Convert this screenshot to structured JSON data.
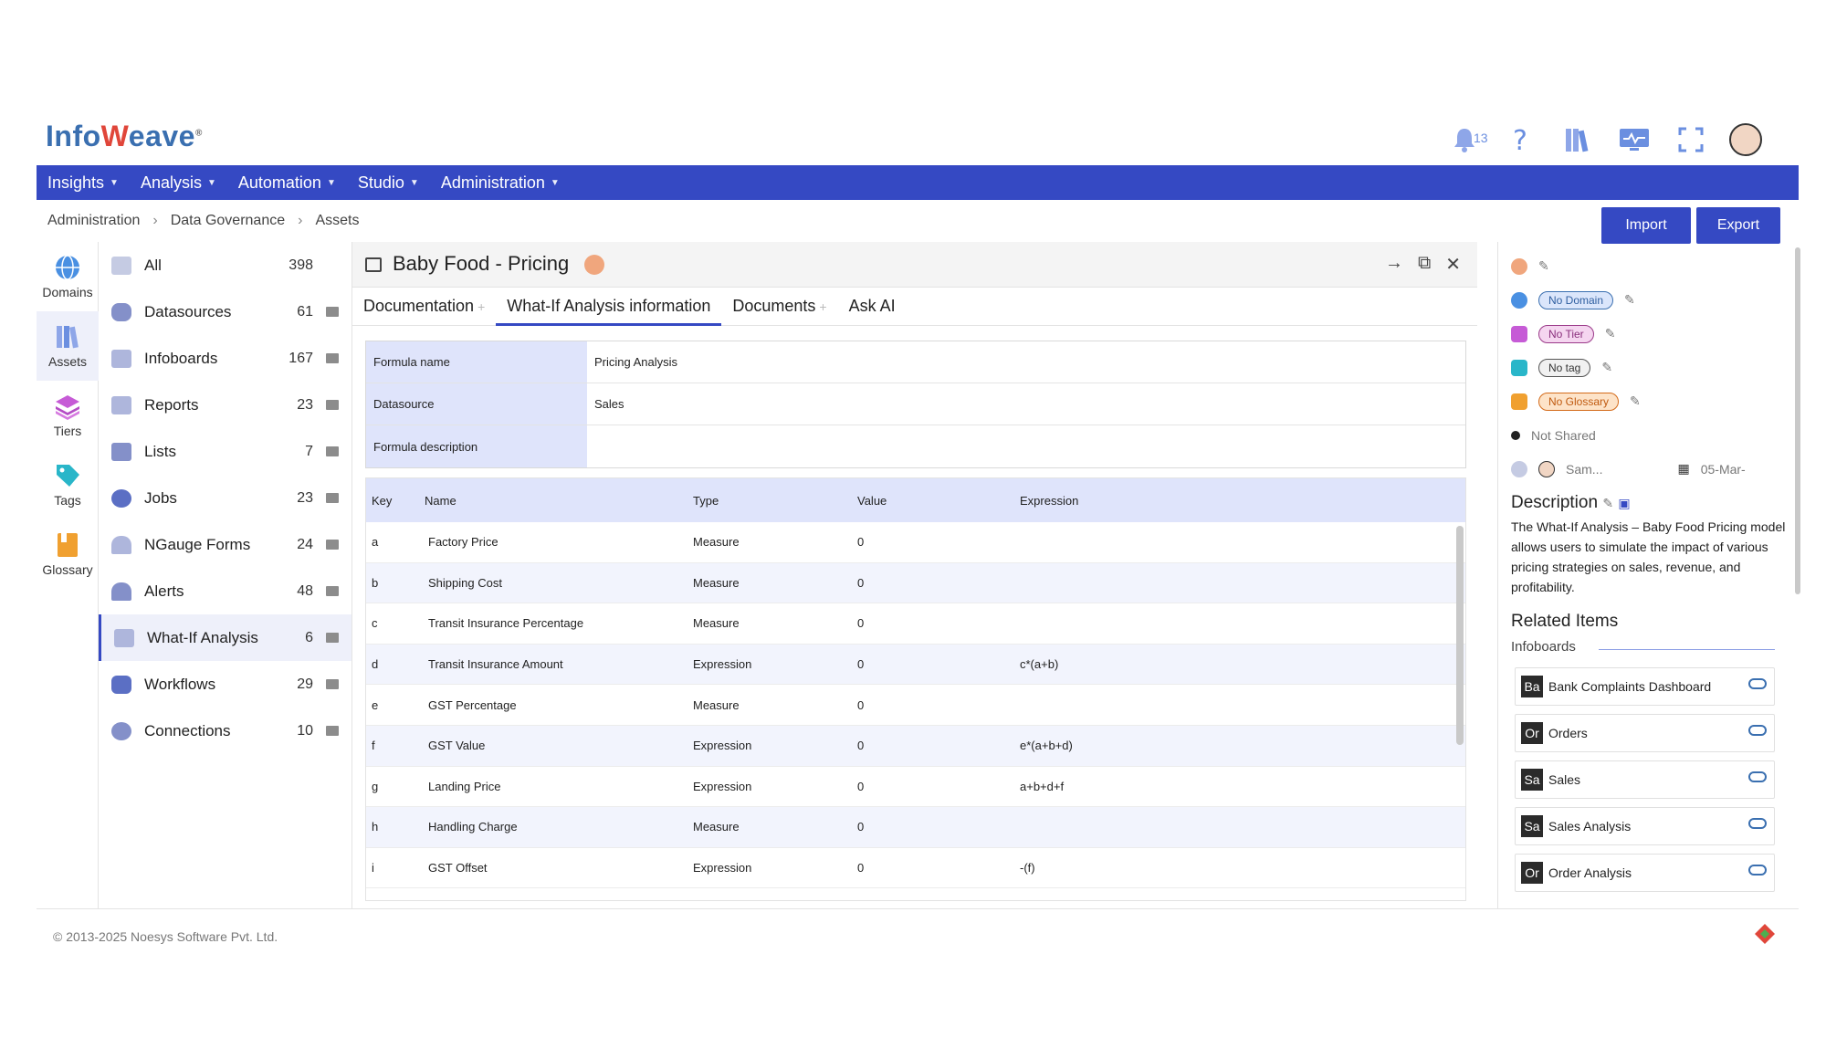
{
  "header": {
    "logo_text": "Infoweave",
    "notification_count": "13"
  },
  "nav": [
    {
      "label": "Insights"
    },
    {
      "label": "Analysis"
    },
    {
      "label": "Automation"
    },
    {
      "label": "Studio"
    },
    {
      "label": "Administration"
    }
  ],
  "breadcrumb": [
    "Administration",
    "Data Governance",
    "Assets"
  ],
  "actions": {
    "import": "Import",
    "export": "Export"
  },
  "rail": [
    {
      "label": "Domains",
      "icon": "globe-icon",
      "color": "#4a90e2"
    },
    {
      "label": "Assets",
      "icon": "books-icon",
      "color": "#6b8fe0"
    },
    {
      "label": "Tiers",
      "icon": "layers-icon",
      "color": "#c65bd6"
    },
    {
      "label": "Tags",
      "icon": "tag-icon",
      "color": "#29b6c9"
    },
    {
      "label": "Glossary",
      "icon": "book-icon",
      "color": "#f0a030"
    }
  ],
  "assets": [
    {
      "label": "All",
      "count": "398"
    },
    {
      "label": "Datasources",
      "count": "61"
    },
    {
      "label": "Infoboards",
      "count": "167"
    },
    {
      "label": "Reports",
      "count": "23"
    },
    {
      "label": "Lists",
      "count": "7"
    },
    {
      "label": "Jobs",
      "count": "23"
    },
    {
      "label": "NGauge Forms",
      "count": "24"
    },
    {
      "label": "Alerts",
      "count": "48"
    },
    {
      "label": "What-If Analysis",
      "count": "6"
    },
    {
      "label": "Workflows",
      "count": "29"
    },
    {
      "label": "Connections",
      "count": "10"
    }
  ],
  "main": {
    "title": "Baby Food - Pricing",
    "tabs": [
      {
        "label": "Documentation"
      },
      {
        "label": "What-If Analysis information"
      },
      {
        "label": "Documents"
      },
      {
        "label": "Ask AI"
      }
    ],
    "info": [
      {
        "key": "Formula name",
        "value": "Pricing Analysis"
      },
      {
        "key": "Datasource",
        "value": "Sales"
      },
      {
        "key": "Formula description",
        "value": ""
      }
    ],
    "grid_headers": [
      "Key",
      "Name",
      "Type",
      "Value",
      "Expression"
    ],
    "grid_rows": [
      {
        "key": "a",
        "name": "Factory Price",
        "type": "Measure",
        "value": "0",
        "expression": ""
      },
      {
        "key": "b",
        "name": "Shipping Cost",
        "type": "Measure",
        "value": "0",
        "expression": ""
      },
      {
        "key": "c",
        "name": "Transit Insurance Percentage",
        "type": "Measure",
        "value": "0",
        "expression": ""
      },
      {
        "key": "d",
        "name": "Transit Insurance Amount",
        "type": "Expression",
        "value": "0",
        "expression": "c*(a+b)"
      },
      {
        "key": "e",
        "name": "GST Percentage",
        "type": "Measure",
        "value": "0",
        "expression": ""
      },
      {
        "key": "f",
        "name": "GST Value",
        "type": "Expression",
        "value": "0",
        "expression": "e*(a+b+d)"
      },
      {
        "key": "g",
        "name": "Landing Price",
        "type": "Expression",
        "value": "0",
        "expression": "a+b+d+f"
      },
      {
        "key": "h",
        "name": "Handling Charge",
        "type": "Measure",
        "value": "0",
        "expression": ""
      },
      {
        "key": "i",
        "name": "GST Offset",
        "type": "Expression",
        "value": "0",
        "expression": "-(f)"
      }
    ]
  },
  "right": {
    "domain": "No Domain",
    "tier": "No Tier",
    "tag": "No tag",
    "glossary": "No Glossary",
    "shared": "Not Shared",
    "owner": "Sam...",
    "date": "05-Mar-",
    "description_title": "Description",
    "description": "The What-If Analysis – Baby Food Pricing model allows users to simulate the impact of various pricing strategies on sales, revenue, and profitability.",
    "related_title": "Related Items",
    "related_sub": "Infoboards",
    "related": [
      {
        "badge": "Ba",
        "name": "Bank Complaints Dashboard"
      },
      {
        "badge": "Or",
        "name": "Orders"
      },
      {
        "badge": "Sa",
        "name": "Sales"
      },
      {
        "badge": "Sa",
        "name": "Sales Analysis"
      },
      {
        "badge": "Or",
        "name": "Order Analysis"
      }
    ]
  },
  "footer": {
    "copyright": "© 2013-2025 Noesys Software Pvt. Ltd."
  }
}
